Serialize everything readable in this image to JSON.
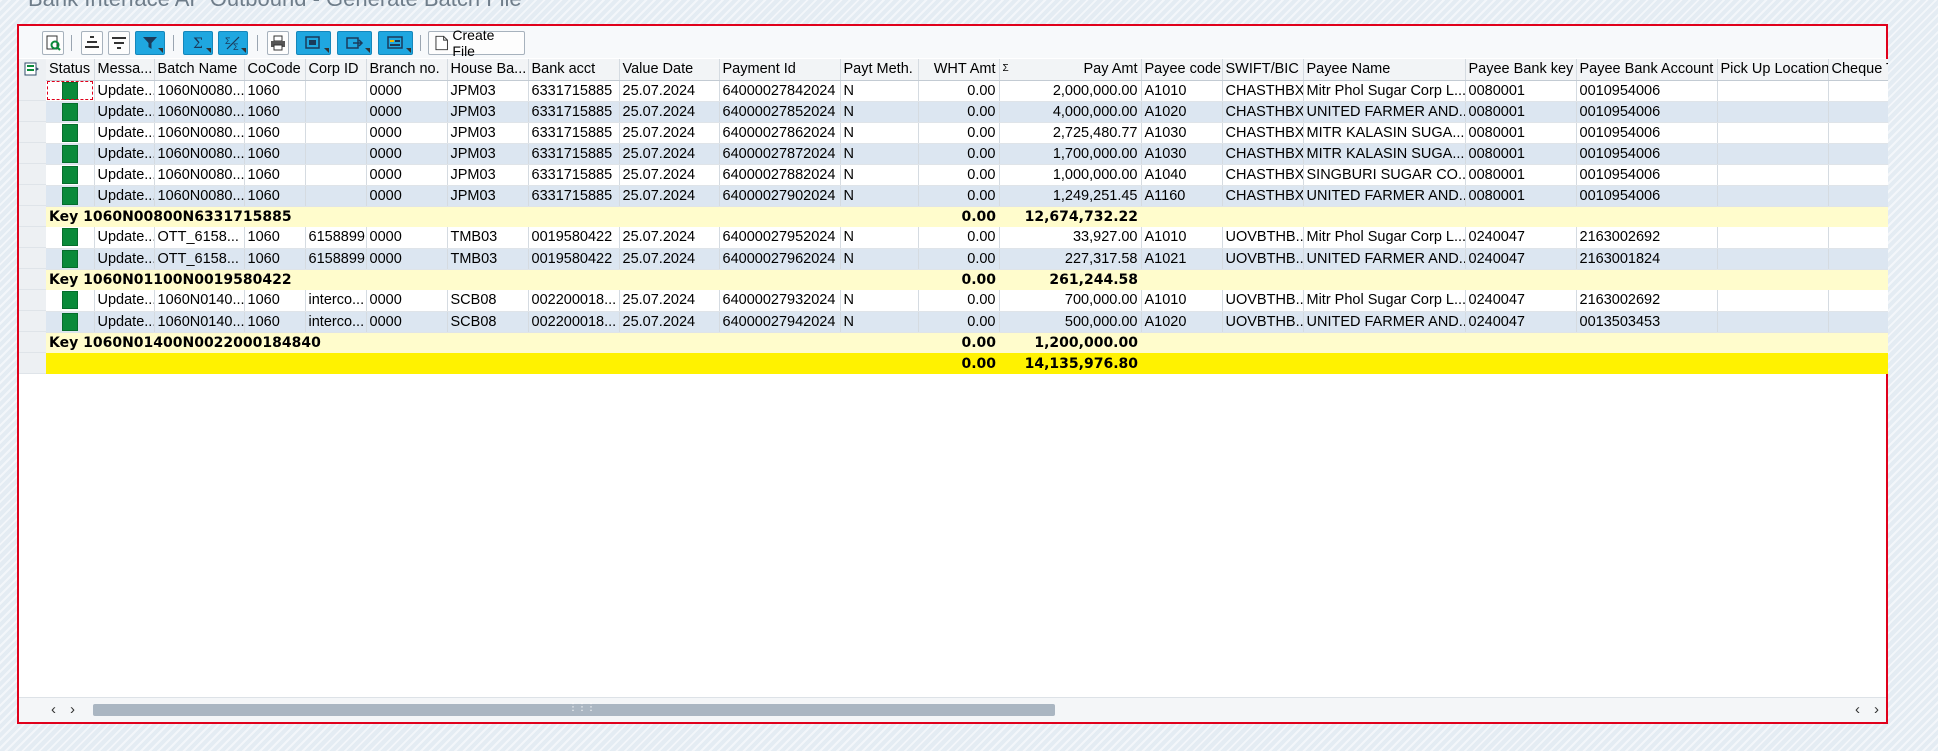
{
  "page_title": "Bank Interface AP Outbound - Generate Batch File",
  "toolbar": {
    "create_file_label": "Create File",
    "icons": [
      "details-icon",
      "sort-ascending-icon",
      "sort-descending-icon",
      "filter-icon",
      "sum-icon",
      "subtotal-icon",
      "print-icon",
      "view-icon",
      "export-icon",
      "layout-icon",
      "create-file-icon"
    ]
  },
  "columns": [
    {
      "key": "status",
      "label": "Status",
      "align": "left"
    },
    {
      "key": "message",
      "label": "Messa...",
      "align": "left"
    },
    {
      "key": "batch",
      "label": "Batch Name",
      "align": "left"
    },
    {
      "key": "cocode",
      "label": "CoCode",
      "align": "left"
    },
    {
      "key": "corp",
      "label": "Corp ID",
      "align": "left"
    },
    {
      "key": "branch",
      "label": "Branch no.",
      "align": "left"
    },
    {
      "key": "house",
      "label": "House Ba...",
      "align": "left"
    },
    {
      "key": "bankacct",
      "label": "Bank acct",
      "align": "left"
    },
    {
      "key": "valdate",
      "label": "Value Date",
      "align": "left"
    },
    {
      "key": "payid",
      "label": "Payment Id",
      "align": "left"
    },
    {
      "key": "paymeth",
      "label": "Payt Meth.",
      "align": "left"
    },
    {
      "key": "wht",
      "label": "WHT Amt",
      "align": "right"
    },
    {
      "key": "payamt",
      "label": "Pay Amt",
      "align": "right"
    },
    {
      "key": "payee",
      "label": "Payee code",
      "align": "left"
    },
    {
      "key": "swift",
      "label": "SWIFT/BIC",
      "align": "left"
    },
    {
      "key": "payeename",
      "label": "Payee Name",
      "align": "left"
    },
    {
      "key": "payeebankkey",
      "label": "Payee Bank key",
      "align": "left"
    },
    {
      "key": "payeebankacct",
      "label": "Payee Bank Account",
      "align": "left"
    },
    {
      "key": "pickup",
      "label": "Pick Up Location",
      "align": "left"
    },
    {
      "key": "cheque",
      "label": "Cheque T...",
      "align": "left"
    }
  ],
  "rows": [
    {
      "type": "data",
      "message": "Update...",
      "batch": "1060N0080...",
      "cocode": "1060",
      "corp": "",
      "branch": "0000",
      "house": "JPM03",
      "bankacct": "6331715885",
      "valdate": "25.07.2024",
      "payid": "64000027842024",
      "paymeth": "N",
      "wht": "0.00",
      "payamt": "2,000,000.00",
      "payee": "A1010",
      "swift": "CHASTHBX",
      "payeename": "Mitr Phol Sugar Corp L...",
      "payeebankkey": "0080001",
      "payeebankacct": "0010954006",
      "pickup": "",
      "cheque": ""
    },
    {
      "type": "data",
      "message": "Update...",
      "batch": "1060N0080...",
      "cocode": "1060",
      "corp": "",
      "branch": "0000",
      "house": "JPM03",
      "bankacct": "6331715885",
      "valdate": "25.07.2024",
      "payid": "64000027852024",
      "paymeth": "N",
      "wht": "0.00",
      "payamt": "4,000,000.00",
      "payee": "A1020",
      "swift": "CHASTHBX",
      "payeename": "UNITED FARMER AND...",
      "payeebankkey": "0080001",
      "payeebankacct": "0010954006",
      "pickup": "",
      "cheque": ""
    },
    {
      "type": "data",
      "message": "Update...",
      "batch": "1060N0080...",
      "cocode": "1060",
      "corp": "",
      "branch": "0000",
      "house": "JPM03",
      "bankacct": "6331715885",
      "valdate": "25.07.2024",
      "payid": "64000027862024",
      "paymeth": "N",
      "wht": "0.00",
      "payamt": "2,725,480.77",
      "payee": "A1030",
      "swift": "CHASTHBX",
      "payeename": "MITR KALASIN SUGA...",
      "payeebankkey": "0080001",
      "payeebankacct": "0010954006",
      "pickup": "",
      "cheque": ""
    },
    {
      "type": "data",
      "message": "Update...",
      "batch": "1060N0080...",
      "cocode": "1060",
      "corp": "",
      "branch": "0000",
      "house": "JPM03",
      "bankacct": "6331715885",
      "valdate": "25.07.2024",
      "payid": "64000027872024",
      "paymeth": "N",
      "wht": "0.00",
      "payamt": "1,700,000.00",
      "payee": "A1030",
      "swift": "CHASTHBX",
      "payeename": "MITR KALASIN SUGA...",
      "payeebankkey": "0080001",
      "payeebankacct": "0010954006",
      "pickup": "",
      "cheque": ""
    },
    {
      "type": "data",
      "message": "Update...",
      "batch": "1060N0080...",
      "cocode": "1060",
      "corp": "",
      "branch": "0000",
      "house": "JPM03",
      "bankacct": "6331715885",
      "valdate": "25.07.2024",
      "payid": "64000027882024",
      "paymeth": "N",
      "wht": "0.00",
      "payamt": "1,000,000.00",
      "payee": "A1040",
      "swift": "CHASTHBX",
      "payeename": "SINGBURI SUGAR CO...",
      "payeebankkey": "0080001",
      "payeebankacct": "0010954006",
      "pickup": "",
      "cheque": ""
    },
    {
      "type": "data",
      "message": "Update...",
      "batch": "1060N0080...",
      "cocode": "1060",
      "corp": "",
      "branch": "0000",
      "house": "JPM03",
      "bankacct": "6331715885",
      "valdate": "25.07.2024",
      "payid": "64000027902024",
      "paymeth": "N",
      "wht": "0.00",
      "payamt": "1,249,251.45",
      "payee": "A1160",
      "swift": "CHASTHBX",
      "payeename": "UNITED FARMER AND...",
      "payeebankkey": "0080001",
      "payeebankacct": "0010954006",
      "pickup": "",
      "cheque": ""
    },
    {
      "type": "subtotal",
      "label": "Key 1060N00800N6331715885",
      "wht": "0.00",
      "payamt": "12,674,732.22"
    },
    {
      "type": "data",
      "message": "Update...",
      "batch": "OTT_6158...",
      "cocode": "1060",
      "corp": "6158899",
      "branch": "0000",
      "house": "TMB03",
      "bankacct": "0019580422",
      "valdate": "25.07.2024",
      "payid": "64000027952024",
      "paymeth": "N",
      "wht": "0.00",
      "payamt": "33,927.00",
      "payee": "A1010",
      "swift": "UOVBTHB...",
      "payeename": "Mitr Phol Sugar Corp L...",
      "payeebankkey": "0240047",
      "payeebankacct": "2163002692",
      "pickup": "",
      "cheque": ""
    },
    {
      "type": "data",
      "message": "Update...",
      "batch": "OTT_6158...",
      "cocode": "1060",
      "corp": "6158899",
      "branch": "0000",
      "house": "TMB03",
      "bankacct": "0019580422",
      "valdate": "25.07.2024",
      "payid": "64000027962024",
      "paymeth": "N",
      "wht": "0.00",
      "payamt": "227,317.58",
      "payee": "A1021",
      "swift": "UOVBTHB...",
      "payeename": "UNITED FARMER AND...",
      "payeebankkey": "0240047",
      "payeebankacct": "2163001824",
      "pickup": "",
      "cheque": ""
    },
    {
      "type": "subtotal",
      "label": "Key 1060N01100N0019580422",
      "wht": "0.00",
      "payamt": "261,244.58"
    },
    {
      "type": "data",
      "message": "Update...",
      "batch": "1060N0140...",
      "cocode": "1060",
      "corp": "interco...",
      "branch": "0000",
      "house": "SCB08",
      "bankacct": "002200018...",
      "valdate": "25.07.2024",
      "payid": "64000027932024",
      "paymeth": "N",
      "wht": "0.00",
      "payamt": "700,000.00",
      "payee": "A1010",
      "swift": "UOVBTHB...",
      "payeename": "Mitr Phol Sugar Corp L...",
      "payeebankkey": "0240047",
      "payeebankacct": "2163002692",
      "pickup": "",
      "cheque": ""
    },
    {
      "type": "data",
      "message": "Update...",
      "batch": "1060N0140...",
      "cocode": "1060",
      "corp": "interco...",
      "branch": "0000",
      "house": "SCB08",
      "bankacct": "002200018...",
      "valdate": "25.07.2024",
      "payid": "64000027942024",
      "paymeth": "N",
      "wht": "0.00",
      "payamt": "500,000.00",
      "payee": "A1020",
      "swift": "UOVBTHB...",
      "payeename": "UNITED FARMER AND...",
      "payeebankkey": "0240047",
      "payeebankacct": "0013503453",
      "pickup": "",
      "cheque": ""
    },
    {
      "type": "subtotal",
      "label": "Key 1060N01400N0022000184840",
      "wht": "0.00",
      "payamt": "1,200,000.00"
    },
    {
      "type": "total",
      "label": "",
      "wht": "0.00",
      "payamt": "14,135,976.80"
    }
  ],
  "scrollbar": {
    "left_arrow": "‹",
    "right_arrow": "›"
  }
}
